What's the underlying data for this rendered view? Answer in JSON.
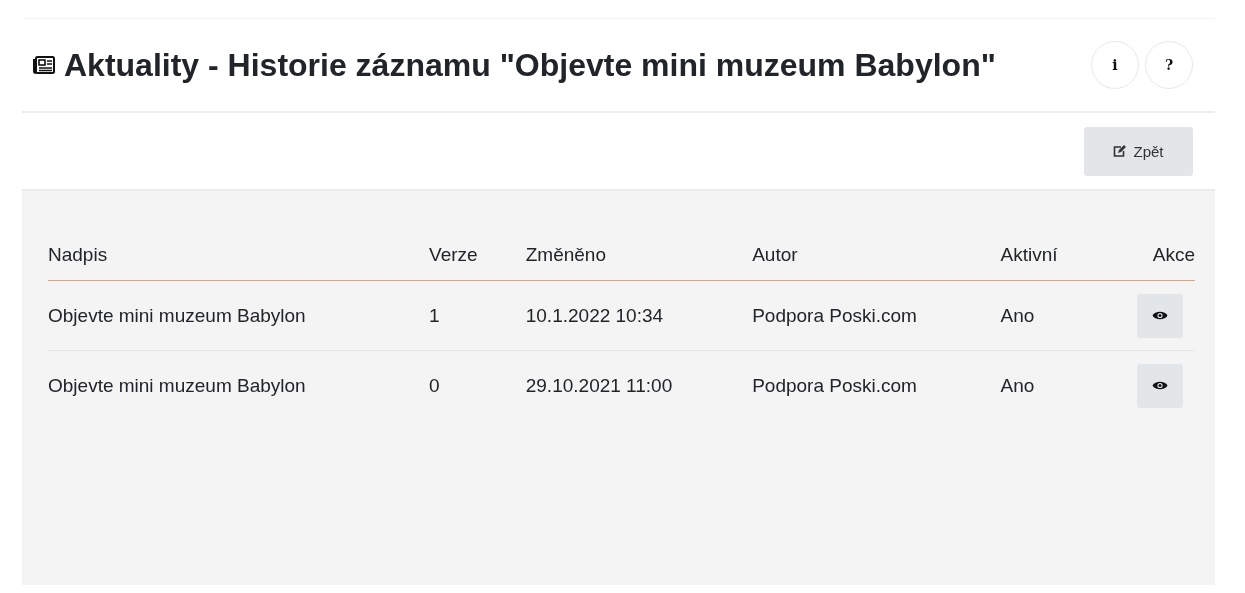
{
  "title": "Aktuality - Historie záznamu \"Objevte mini muzeum Babylon\"",
  "header_buttons": [
    "i",
    "?"
  ],
  "back_button": {
    "label": "Zpět"
  },
  "table": {
    "columns": [
      "Nadpis",
      "Verze",
      "Změněno",
      "Autor",
      "Aktivní",
      "Akce"
    ],
    "rows": [
      {
        "title": "Objevte mini muzeum Babylon",
        "version": "1",
        "changed": "10.1.2022 10:34",
        "author": "Podpora Poski.com",
        "active": "Ano"
      },
      {
        "title": "Objevte mini muzeum Babylon",
        "version": "0",
        "changed": "29.10.2021 11:00",
        "author": "Podpora Poski.com",
        "active": "Ano"
      }
    ]
  }
}
